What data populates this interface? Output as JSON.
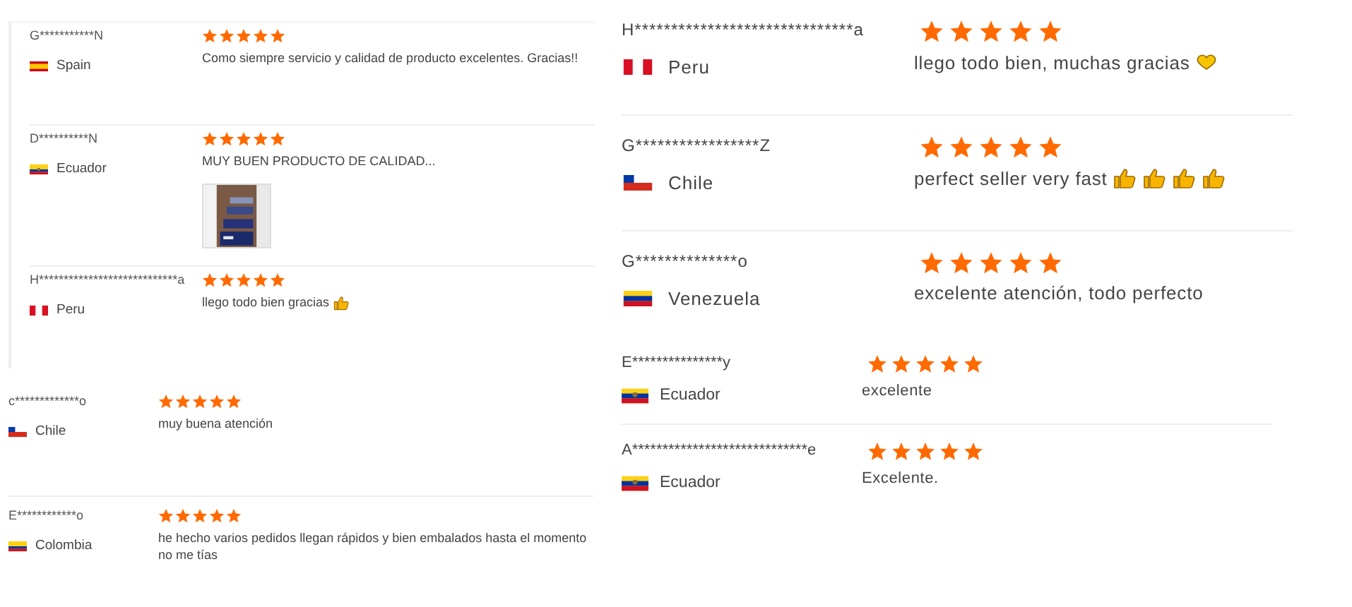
{
  "panels": [
    {
      "kind": "small",
      "reviews": [
        {
          "name": "G***********N",
          "flag": {
            "kind": "spain"
          },
          "country": "Spain",
          "stars": 5,
          "comment": "Como siempre servicio y calidad de producto excelentes. Gracias!!"
        },
        {
          "name": "D**********N",
          "flag": {
            "kind": "ecuador"
          },
          "country": "Ecuador",
          "stars": 5,
          "comment": "MUY BUEN PRODUCTO DE CALIDAD...",
          "photos": [
            {
              "kind": "picture"
            }
          ]
        },
        {
          "name": "H****************************a",
          "flag": {
            "kind": "peru"
          },
          "country": "Peru",
          "stars": 5,
          "comment": "llego todo bien gracias",
          "emojis": [
            {
              "kind": "thumbs_up"
            }
          ]
        }
      ]
    },
    {
      "kind": "small",
      "reviews": [
        {
          "name": "c*************o",
          "flag": {
            "kind": "chile"
          },
          "country": "Chile",
          "stars": 5,
          "comment": "muy buena atención"
        },
        {
          "name": "E************o",
          "flag": {
            "kind": "colombia"
          },
          "country": "Colombia",
          "stars": 5,
          "comment": "he hecho varios pedidos llegan rápidos y bien embalados hasta el momento no me tías"
        }
      ]
    },
    {
      "kind": "large",
      "reviews": [
        {
          "name": "H******************************a",
          "flag": {
            "kind": "peru"
          },
          "country": "Peru",
          "stars": 5,
          "comment": "llego todo bien, muchas gracias",
          "emojis": [
            {
              "kind": "heart"
            }
          ]
        },
        {
          "name": "G*****************Z",
          "flag": {
            "kind": "chile"
          },
          "country": "Chile",
          "stars": 5,
          "comment": "perfect seller very fast",
          "emojis": [
            {
              "kind": "thumbs_up"
            },
            {
              "kind": "thumbs_up"
            },
            {
              "kind": "thumbs_up"
            },
            {
              "kind": "thumbs_up"
            }
          ]
        },
        {
          "name": "G**************o",
          "flag": {
            "kind": "venezuela"
          },
          "country": "Venezuela",
          "stars": 5,
          "comment": "excelente atención, todo perfecto"
        }
      ]
    },
    {
      "kind": "medium",
      "reviews": [
        {
          "name": "E***************y",
          "flag": {
            "kind": "ecuador"
          },
          "country": "Ecuador",
          "stars": 5,
          "comment": "excelente"
        },
        {
          "name": "A*****************************e",
          "flag": {
            "kind": "ecuador"
          },
          "country": "Ecuador",
          "stars": 5,
          "comment": "Excelente."
        }
      ]
    }
  ]
}
